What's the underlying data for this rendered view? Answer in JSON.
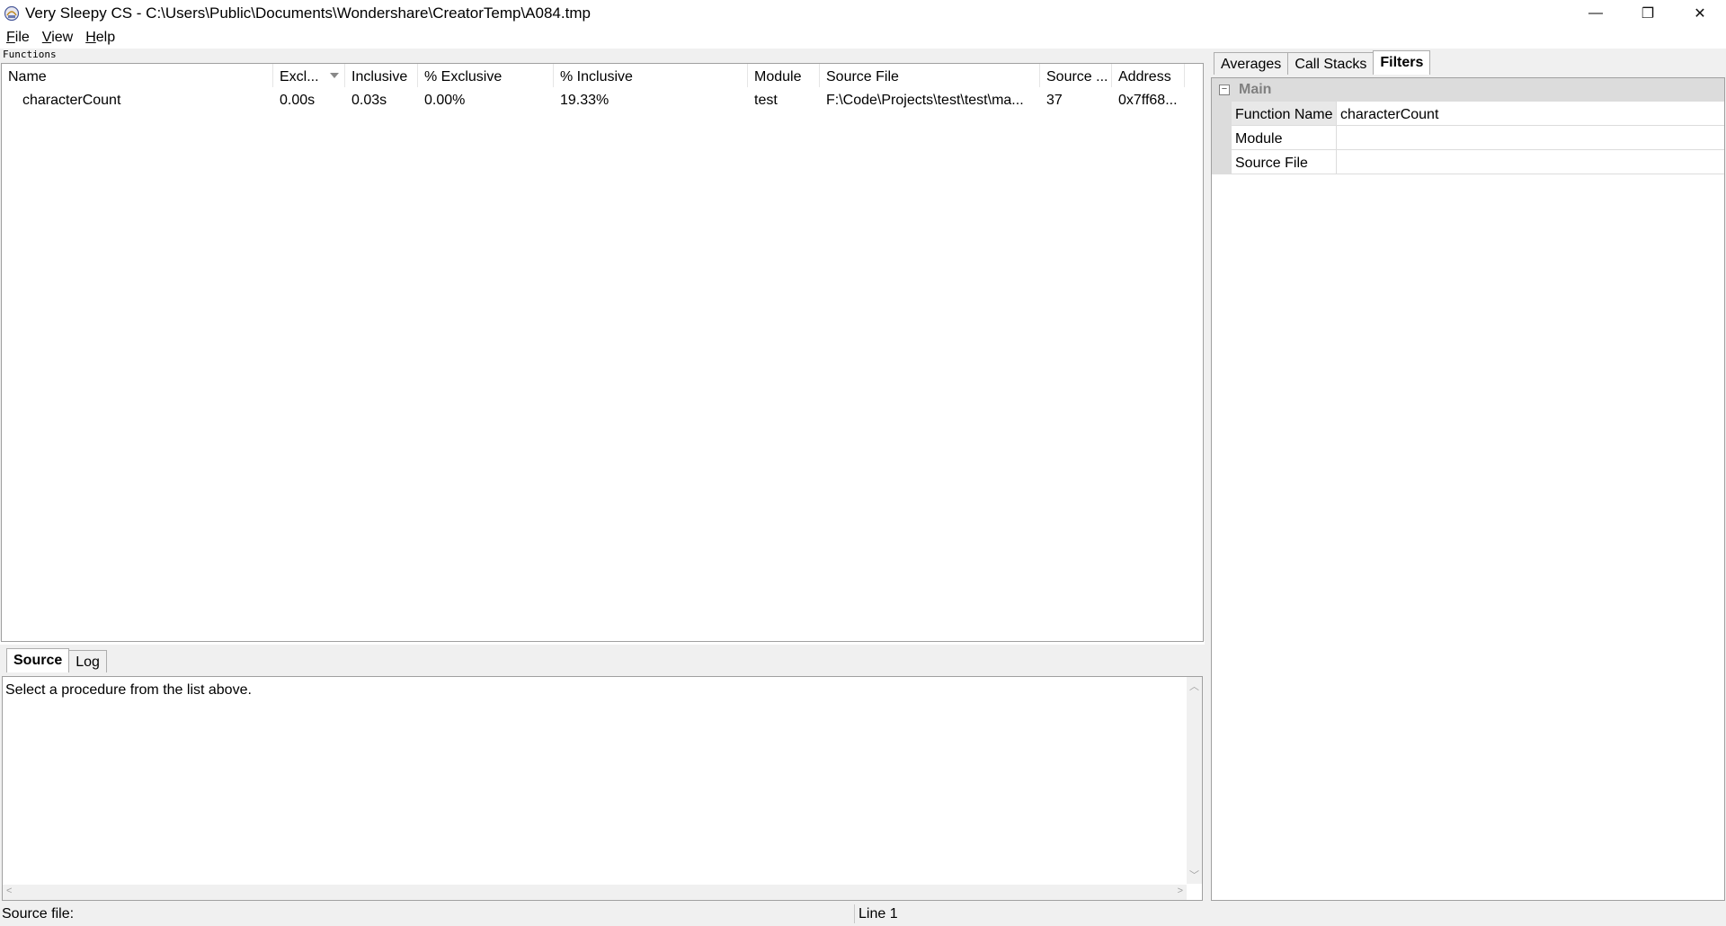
{
  "window": {
    "title": "Very Sleepy CS - C:\\Users\\Public\\Documents\\Wondershare\\CreatorTemp\\A084.tmp",
    "minimize": "—",
    "maximize": "❐",
    "close": "✕"
  },
  "menu": {
    "items": [
      {
        "key": "F",
        "rest": "ile"
      },
      {
        "key": "V",
        "rest": "iew"
      },
      {
        "key": "H",
        "rest": "elp"
      }
    ]
  },
  "functions_panel": {
    "caption": "Functions",
    "columns": [
      "Name",
      "Excl...",
      "Inclusive",
      "% Exclusive",
      "% Inclusive",
      "Module",
      "Source File",
      "Source ...",
      "Address"
    ],
    "rows": [
      {
        "name": "characterCount",
        "exclusive": "0.00s",
        "inclusive": "0.03s",
        "pct_exclusive": "0.00%",
        "pct_inclusive": "19.33%",
        "module": "test",
        "source_file": "F:\\Code\\Projects\\test\\test\\ma...",
        "source_line": "37",
        "address": "0x7ff68..."
      }
    ]
  },
  "bottom_tabs": {
    "tabs": [
      "Source",
      "Log"
    ],
    "active": "Source",
    "source_text": "Select a procedure from the list above."
  },
  "right_tabs": {
    "tabs": [
      "Averages",
      "Call Stacks",
      "Filters"
    ],
    "active": "Filters"
  },
  "filters": {
    "category": "Main",
    "expander": "−",
    "props": [
      {
        "name": "Function Name",
        "value": "characterCount"
      },
      {
        "name": "Module",
        "value": ""
      },
      {
        "name": "Source File",
        "value": ""
      }
    ]
  },
  "statusbar": {
    "source_file_label": "Source file:",
    "line": "Line 1"
  }
}
